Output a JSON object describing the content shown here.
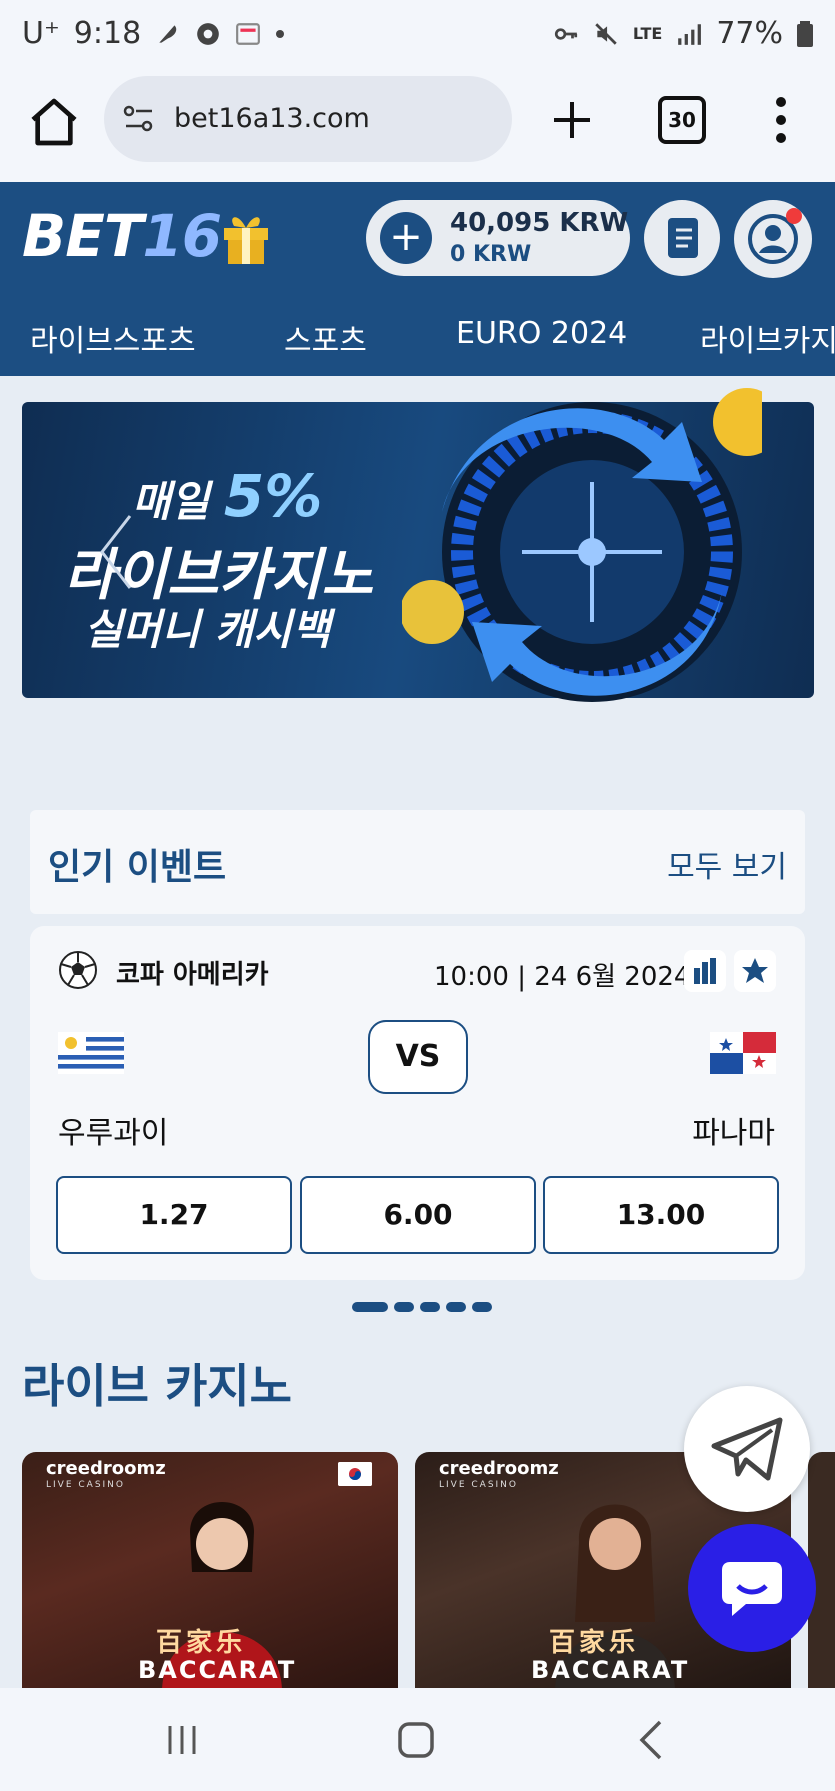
{
  "status_bar": {
    "carrier": "U⁺",
    "time": "9:18",
    "network": "LTE",
    "battery": "77%"
  },
  "browser": {
    "url": "bet16a13.com",
    "tab_count": "30"
  },
  "header": {
    "logo_prefix": "BET",
    "logo_number": "16",
    "balance_main": "40,095 KRW",
    "balance_sub": "0 KRW"
  },
  "nav": {
    "items": [
      "라이브스포츠",
      "스포츠",
      "EURO 2024",
      "라이브카지노"
    ]
  },
  "banner": {
    "line1_prefix": "매일 ",
    "line1_percent": "5%",
    "line2": "라이브카지노",
    "line3": "실머니 캐시백"
  },
  "events": {
    "title": "인기 이벤트",
    "see_all": "모두 보기",
    "match": {
      "league": "코파 아메리카",
      "datetime": "10:00 | 24 6월 2024",
      "vs": "VS",
      "home": "우루과이",
      "away": "파나마",
      "odds": [
        "1.27",
        "6.00",
        "13.00"
      ]
    }
  },
  "casino": {
    "title": "라이브 카지노",
    "cards": [
      {
        "brand": "creedroomz",
        "sub": "LIVE CASINO",
        "hanzi": "百家乐",
        "game": "BACCARAT"
      },
      {
        "brand": "creedroomz",
        "sub": "LIVE CASINO",
        "hanzi": "百家乐",
        "game": "BACCARAT"
      }
    ]
  },
  "colors": {
    "brand_blue": "#1c4e82",
    "chat_button": "#2a1fe6",
    "accent_red": "#ef3b3b"
  }
}
